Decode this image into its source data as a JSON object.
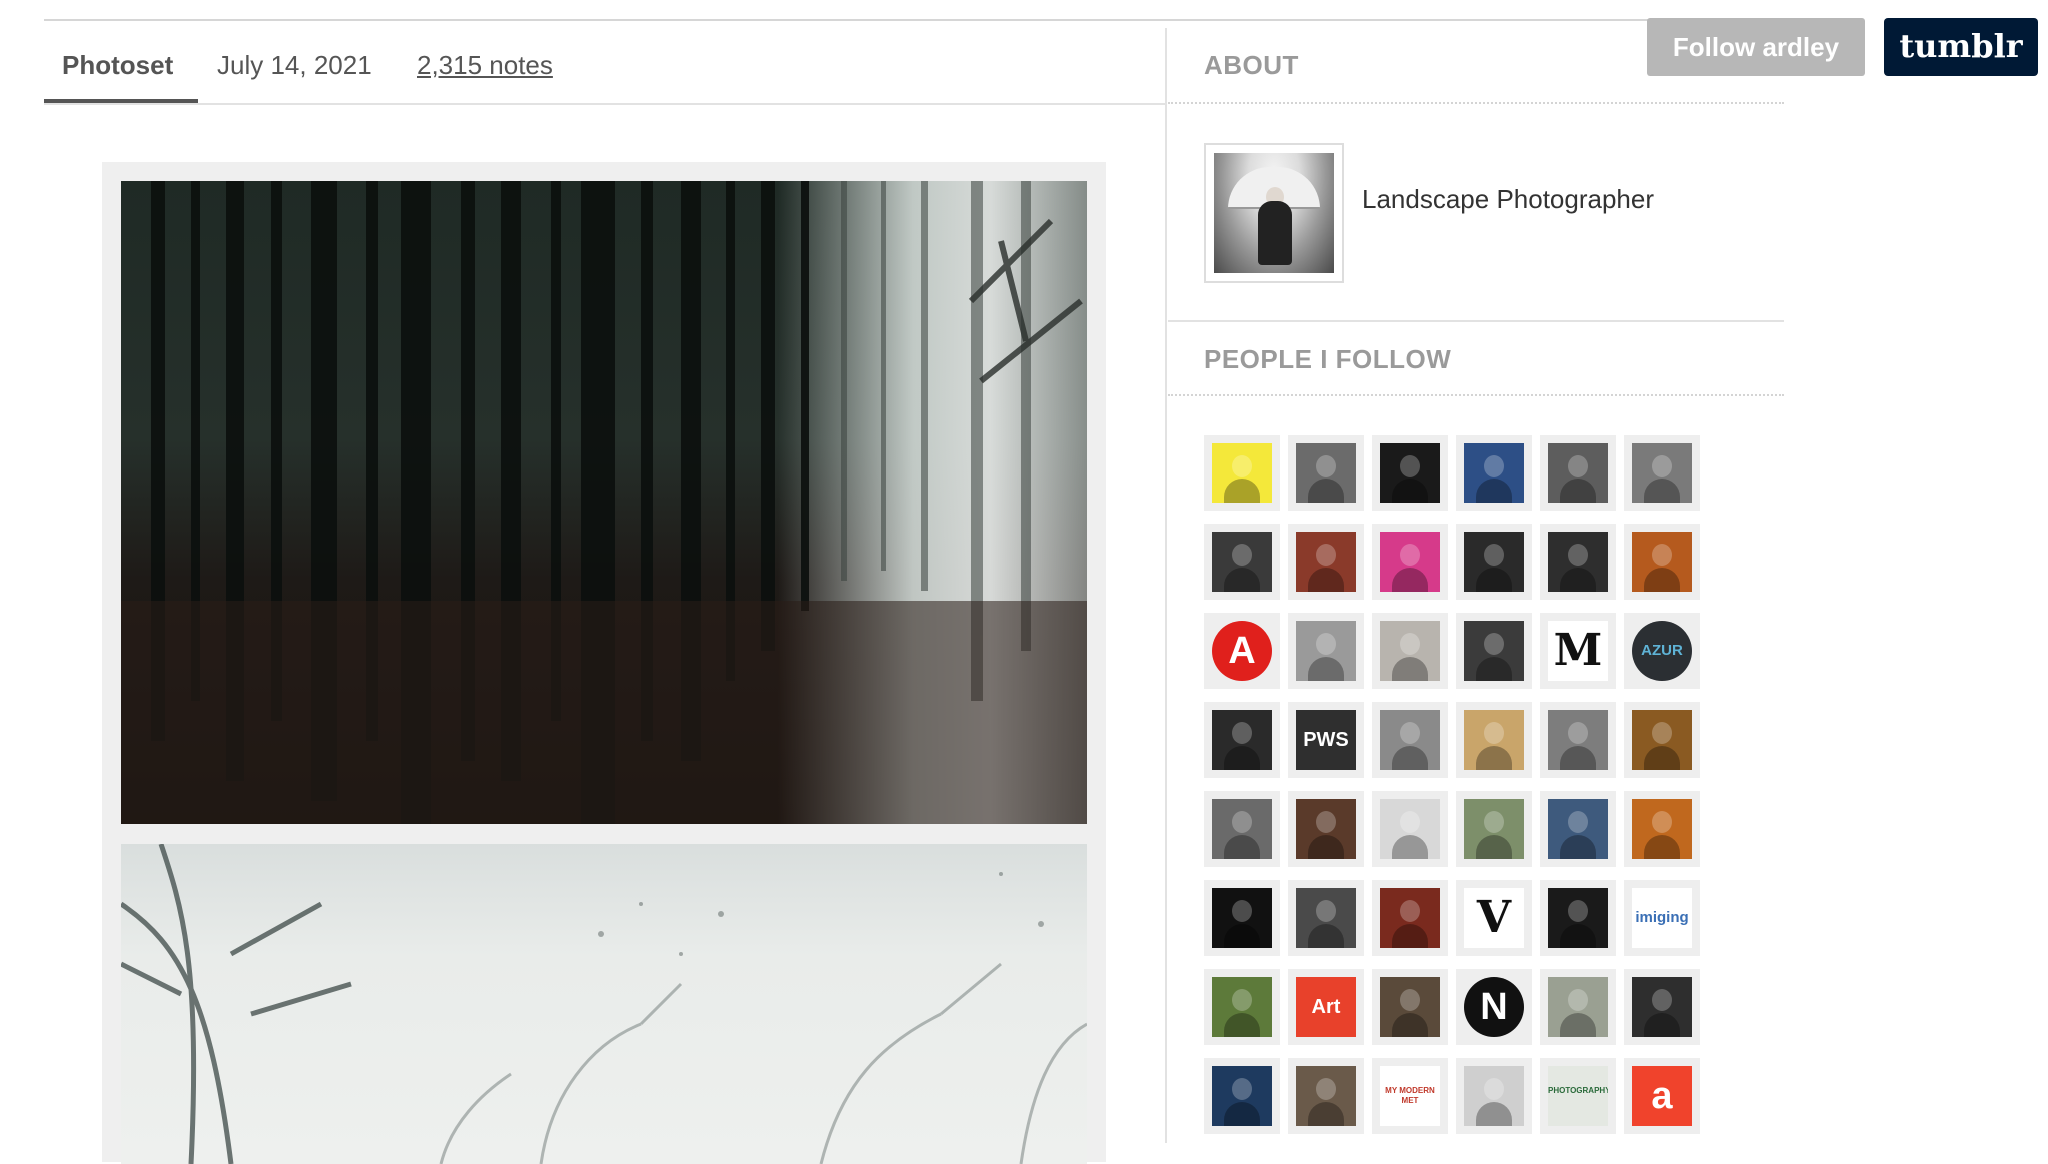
{
  "post": {
    "type": "Photoset",
    "date": "July 14, 2021",
    "notes": "2,315 notes"
  },
  "controls": {
    "follow": "Follow ardley",
    "brand": "tumblr"
  },
  "about": {
    "title": "ABOUT",
    "description": "Landscape Photographer"
  },
  "following": {
    "title": "PEOPLE I FOLLOW",
    "avatars": [
      {
        "icon": "anime-avatar-icon",
        "bg": "#f4e83a",
        "fg": "#111",
        "text": ""
      },
      {
        "icon": "blurred-face-avatar-icon",
        "bg": "#6b6b6b",
        "fg": "#fff",
        "text": ""
      },
      {
        "icon": "masked-figure-avatar-icon",
        "bg": "#1a1a1a",
        "fg": "#fff",
        "text": ""
      },
      {
        "icon": "sunset-silhouette-avatar-icon",
        "bg": "#2d4f86",
        "fg": "#fff",
        "text": ""
      },
      {
        "icon": "bw-portrait-avatar-icon",
        "bg": "#5d5d5d",
        "fg": "#fff",
        "text": ""
      },
      {
        "icon": "bw-photo-avatar-icon",
        "bg": "#7a7a7a",
        "fg": "#fff",
        "text": ""
      },
      {
        "icon": "woman-portrait-avatar-icon",
        "bg": "#3a3a3a",
        "fg": "#fff",
        "text": ""
      },
      {
        "icon": "redhead-portrait-avatar-icon",
        "bg": "#8a3a2a",
        "fg": "#fff",
        "text": ""
      },
      {
        "icon": "colorful-pattern-avatar-icon",
        "bg": "#d63a8a",
        "fg": "#fff",
        "text": ""
      },
      {
        "icon": "abstract-bw-avatar-icon",
        "bg": "#2a2a2a",
        "fg": "#fff",
        "text": ""
      },
      {
        "icon": "man-with-flower-avatar-icon",
        "bg": "#2e2e2e",
        "fg": "#fff",
        "text": ""
      },
      {
        "icon": "candle-light-avatar-icon",
        "bg": "#b55a1e",
        "fg": "#fff",
        "text": ""
      },
      {
        "icon": "red-a-logo-icon",
        "bg": "#e0201c",
        "fg": "#fff",
        "text": "A"
      },
      {
        "icon": "bw-face-avatar-icon",
        "bg": "#9a9a9a",
        "fg": "#fff",
        "text": ""
      },
      {
        "icon": "beach-figure-avatar-icon",
        "bg": "#b8b4ae",
        "fg": "#fff",
        "text": ""
      },
      {
        "icon": "man-dark-avatar-icon",
        "bg": "#3b3b3b",
        "fg": "#fff",
        "text": ""
      },
      {
        "icon": "letter-m-logo-icon",
        "bg": "#ffffff",
        "fg": "#111",
        "text": "M"
      },
      {
        "icon": "azur-grau-logo-icon",
        "bg": "#2b2f33",
        "fg": "#5fb3d6",
        "text": "AZUR"
      },
      {
        "icon": "man-camera-avatar-icon",
        "bg": "#2a2a2a",
        "fg": "#fff",
        "text": ""
      },
      {
        "icon": "pws-logo-icon",
        "bg": "#2f2f2f",
        "fg": "#fff",
        "text": "PWS"
      },
      {
        "icon": "bw-couple-avatar-icon",
        "bg": "#8a8a8a",
        "fg": "#fff",
        "text": ""
      },
      {
        "icon": "desert-figure-avatar-icon",
        "bg": "#c9a56a",
        "fg": "#fff",
        "text": ""
      },
      {
        "icon": "curly-hair-avatar-icon",
        "bg": "#7d7d7d",
        "fg": "#fff",
        "text": ""
      },
      {
        "icon": "sepia-selfie-avatar-icon",
        "bg": "#8a5a22",
        "fg": "#fff",
        "text": ""
      },
      {
        "icon": "young-man-avatar-icon",
        "bg": "#6a6a6a",
        "fg": "#fff",
        "text": ""
      },
      {
        "icon": "street-scene-avatar-icon",
        "bg": "#5a3a2a",
        "fg": "#fff",
        "text": ""
      },
      {
        "icon": "hand-sculpture-avatar-icon",
        "bg": "#d8d8d8",
        "fg": "#333",
        "text": ""
      },
      {
        "icon": "green-abstract-avatar-icon",
        "bg": "#7d8f6a",
        "fg": "#fff",
        "text": ""
      },
      {
        "icon": "misty-lake-avatar-icon",
        "bg": "#3e5a7d",
        "fg": "#fff",
        "text": ""
      },
      {
        "icon": "orange-portrait-avatar-icon",
        "bg": "#c0681e",
        "fg": "#fff",
        "text": ""
      },
      {
        "icon": "framed-figure-avatar-icon",
        "bg": "#111111",
        "fg": "#fff",
        "text": ""
      },
      {
        "icon": "bearded-man-avatar-icon",
        "bg": "#4a4a4a",
        "fg": "#fff",
        "text": ""
      },
      {
        "icon": "red-hair-woman-avatar-icon",
        "bg": "#7a2a1e",
        "fg": "#fff",
        "text": ""
      },
      {
        "icon": "letter-v-logo-icon",
        "bg": "#ffffff",
        "fg": "#111",
        "text": "V"
      },
      {
        "icon": "doorway-figure-avatar-icon",
        "bg": "#1a1a1a",
        "fg": "#fff",
        "text": ""
      },
      {
        "icon": "imiging-logo-icon",
        "bg": "#ffffff",
        "fg": "#3a6fb5",
        "text": "imiging"
      },
      {
        "icon": "forest-walker-avatar-icon",
        "bg": "#5d7a3a",
        "fg": "#fff",
        "text": ""
      },
      {
        "icon": "art-logo-icon",
        "bg": "#e8412b",
        "fg": "#fff",
        "text": "Art"
      },
      {
        "icon": "man-glasses-avatar-icon",
        "bg": "#5a4a3a",
        "fg": "#fff",
        "text": ""
      },
      {
        "icon": "letter-n-logo-icon",
        "bg": "#ffffff",
        "fg": "#ffffff",
        "text": "N"
      },
      {
        "icon": "standing-figure-avatar-icon",
        "bg": "#9aa092",
        "fg": "#fff",
        "text": ""
      },
      {
        "icon": "woman-dark-avatar-icon",
        "bg": "#2e2e2e",
        "fg": "#fff",
        "text": ""
      },
      {
        "icon": "sunglasses-man-avatar-icon",
        "bg": "#1e3a5f",
        "fg": "#fff",
        "text": ""
      },
      {
        "icon": "rocky-landscape-avatar-icon",
        "bg": "#6a5a4a",
        "fg": "#fff",
        "text": ""
      },
      {
        "icon": "my-modern-met-logo-icon",
        "bg": "#ffffff",
        "fg": "#c0392b",
        "text": "MY MODERN MET"
      },
      {
        "icon": "white-car-avatar-icon",
        "bg": "#cfcfcf",
        "fg": "#333",
        "text": ""
      },
      {
        "icon": "photography-sign-avatar-icon",
        "bg": "#e4e8e2",
        "fg": "#2a6a3a",
        "text": "PHOTOGRAPHY"
      },
      {
        "icon": "letter-a-logo-icon",
        "bg": "#f0432c",
        "fg": "#fff",
        "text": "a"
      }
    ]
  }
}
